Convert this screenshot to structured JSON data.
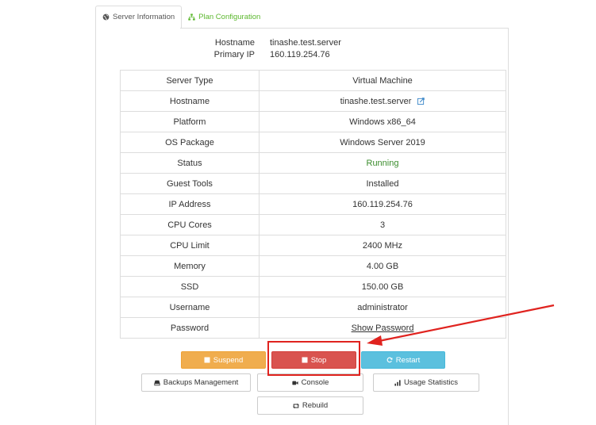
{
  "tabs": [
    {
      "label": "Server Information",
      "icon": "globe-icon",
      "active": true
    },
    {
      "label": "Plan Configuration",
      "icon": "sitemap-icon",
      "active": false
    }
  ],
  "header": {
    "hostname_label": "Hostname",
    "hostname_value": "tinashe.test.server",
    "ip_label": "Primary IP",
    "ip_value": "160.119.254.76"
  },
  "info_table": [
    {
      "label": "Server Type",
      "value": "Virtual Machine"
    },
    {
      "label": "Hostname",
      "value": "tinashe.test.server"
    },
    {
      "label": "Platform",
      "value": "Windows x86_64"
    },
    {
      "label": "OS Package",
      "value": "Windows Server 2019"
    },
    {
      "label": "Status",
      "value": "Running"
    },
    {
      "label": "Guest Tools",
      "value": "Installed"
    },
    {
      "label": "IP Address",
      "value": "160.119.254.76"
    },
    {
      "label": "CPU Cores",
      "value": "3"
    },
    {
      "label": "CPU Limit",
      "value": "2400 MHz"
    },
    {
      "label": "Memory",
      "value": "4.00 GB"
    },
    {
      "label": "SSD",
      "value": "150.00 GB"
    },
    {
      "label": "Username",
      "value": "administrator"
    },
    {
      "label": "Password",
      "value": "Show Password"
    }
  ],
  "actions": {
    "suspend": "Suspend",
    "stop": "Stop",
    "restart": "Restart",
    "backups": "Backups Management",
    "console": "Console",
    "usage": "Usage Statistics",
    "rebuild": "Rebuild"
  },
  "colors": {
    "suspend": "#f0ad4e",
    "stop": "#d9534f",
    "restart": "#5bc0de",
    "running": "#3a8c2c",
    "tab_link": "#5cb82e",
    "annotation": "#e0231f"
  }
}
